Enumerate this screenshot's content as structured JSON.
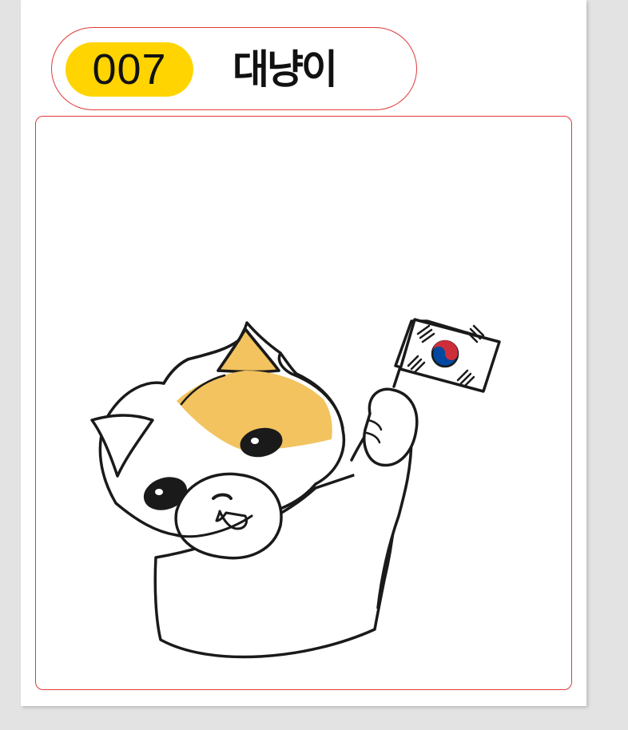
{
  "card": {
    "number": "007",
    "name": "대냥이"
  },
  "colors": {
    "badge": "#ffd400",
    "border": "#e03a3a",
    "cat_patch": "#f2c35f",
    "outline": "#1a1a1a",
    "flag_red": "#cd2e3a",
    "flag_blue": "#0047a0"
  },
  "illustration": {
    "subject": "cat-holding-korean-flag"
  }
}
